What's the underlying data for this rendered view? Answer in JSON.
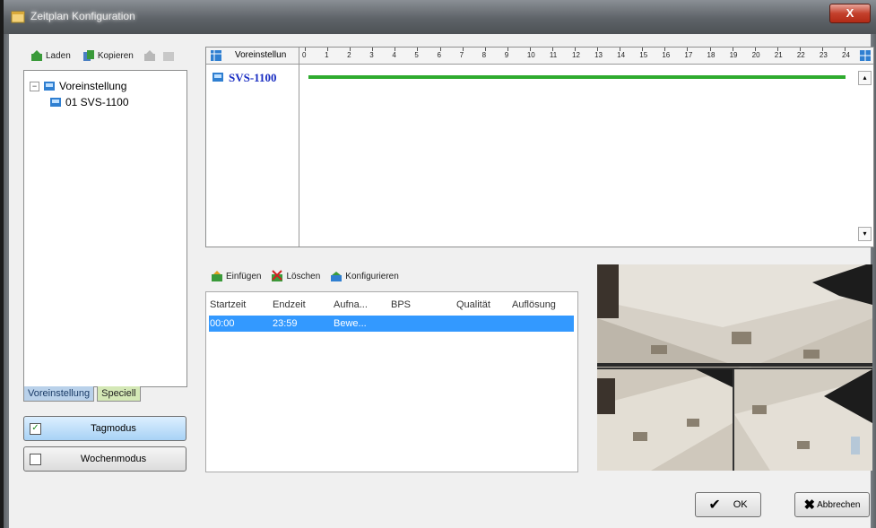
{
  "window": {
    "title": "Zeitplan Konfiguration",
    "close_label": "X"
  },
  "left_toolbar": {
    "load_label": "Laden",
    "copy_label": "Kopieren"
  },
  "tree": {
    "root_label": "Voreinstellung",
    "root_expander": "−",
    "child_label": "01 SVS-1100"
  },
  "tabs": {
    "preset_label": "Voreinstellung",
    "special_label": "Speciell"
  },
  "modes": {
    "day_label": "Tagmodus",
    "day_checked": true,
    "week_label": "Wochenmodus",
    "week_checked": false
  },
  "schedule": {
    "header_label": "Voreinstellun",
    "hours": [
      "0",
      "1",
      "2",
      "3",
      "4",
      "5",
      "6",
      "7",
      "8",
      "9",
      "10",
      "11",
      "12",
      "13",
      "14",
      "15",
      "16",
      "17",
      "18",
      "19",
      "20",
      "21",
      "22",
      "23",
      "24"
    ],
    "row_label": "SVS-1100",
    "bar_color": "#2eab2e"
  },
  "event_toolbar": {
    "insert_label": "Einfügen",
    "delete_label": "Löschen",
    "configure_label": "Konfigurieren"
  },
  "event_table": {
    "columns": [
      "Startzeit",
      "Endzeit",
      "Aufna...",
      "BPS",
      "Qualität",
      "Auflösung"
    ],
    "rows": [
      {
        "start": "00:00",
        "end": "23:59",
        "record": "Bewe..."
      }
    ],
    "selected_color": "#3399ff"
  },
  "buttons": {
    "ok_label": "OK",
    "cancel_label": "Abbrechen"
  }
}
